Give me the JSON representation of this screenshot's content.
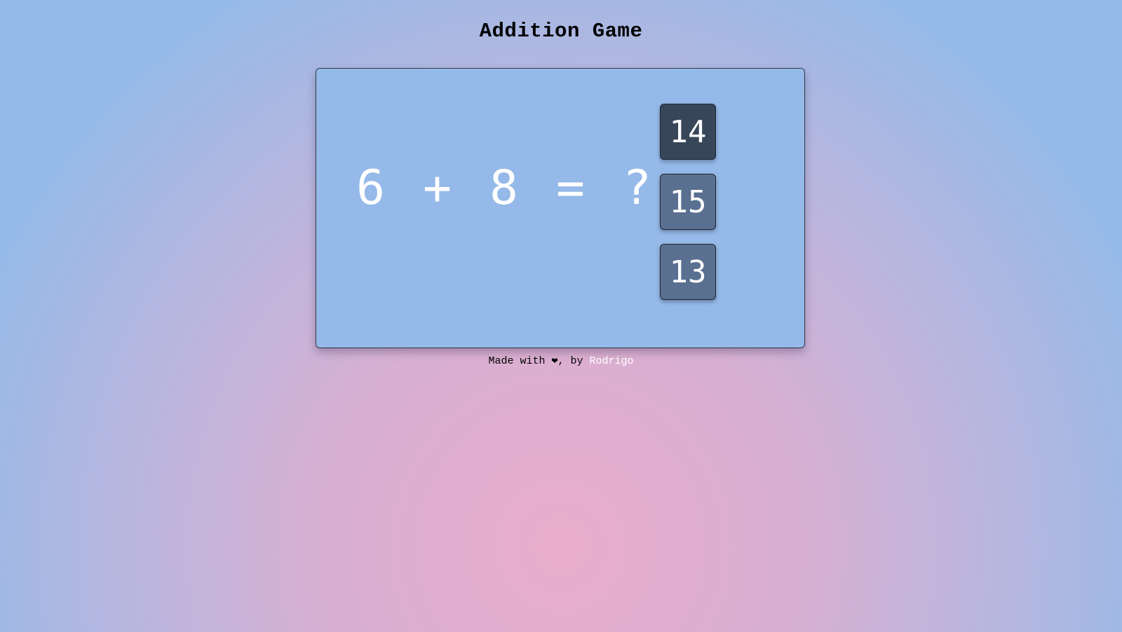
{
  "header": {
    "title": "Addition Game"
  },
  "equation": {
    "operand_a": "6",
    "operator": "+",
    "operand_b": "8",
    "equals": "=",
    "unknown": "?"
  },
  "options": [
    {
      "label": "14",
      "state": "highlighted"
    },
    {
      "label": "15",
      "state": "normal"
    },
    {
      "label": "13",
      "state": "normal"
    }
  ],
  "footer": {
    "prefix": "Made with ",
    "heart": "❤",
    "middle": ", by ",
    "author_link": "Rodrigo"
  },
  "colors": {
    "card_background": "#95b9e8",
    "option_normal": "#5a7090",
    "option_highlighted": "#384659",
    "text_light": "#ffffff"
  }
}
